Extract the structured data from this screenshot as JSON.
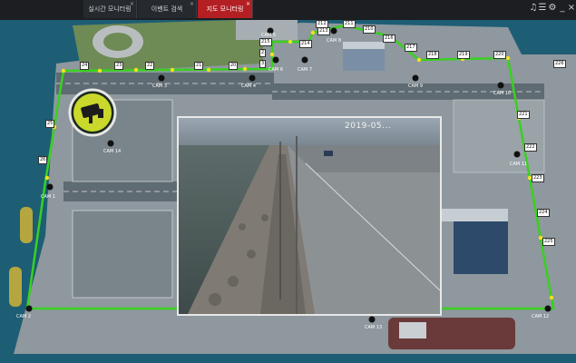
{
  "tabs": [
    {
      "label": "실시간 모니터링",
      "active": false
    },
    {
      "label": "이벤트 검색",
      "active": false
    },
    {
      "label": "지도 모니터링",
      "active": true
    }
  ],
  "system_icons": [
    "bell-icon",
    "menu-icon",
    "gear-icon",
    "minimize-icon",
    "close-icon"
  ],
  "segments": [
    "24",
    "23",
    "22",
    "21",
    "20",
    "25",
    "26",
    "2",
    "3",
    "212",
    "211",
    "210",
    "216",
    "217",
    "218",
    "219",
    "213",
    "214",
    "215",
    "220",
    "221",
    "222",
    "223",
    "224",
    "225",
    "226"
  ],
  "cameras": [
    {
      "label": "CAM 1"
    },
    {
      "label": "CAM 2"
    },
    {
      "label": "CAM 3"
    },
    {
      "label": "CAM 4"
    },
    {
      "label": "CAM 5"
    },
    {
      "label": "CAM 6"
    },
    {
      "label": "CAM 7"
    },
    {
      "label": "CAM 8"
    },
    {
      "label": "CAM 9"
    },
    {
      "label": "CAM 10"
    },
    {
      "label": "CAM 11"
    },
    {
      "label": "CAM 12"
    },
    {
      "label": "CAM 13"
    },
    {
      "label": "CAM 14"
    }
  ],
  "popup": {
    "timestamp": "2019-05..."
  },
  "colors": {
    "fence_line": "#39d020",
    "node": "#f2e21a",
    "active_tab": "#b31f23",
    "sea": "#1d5e74"
  }
}
